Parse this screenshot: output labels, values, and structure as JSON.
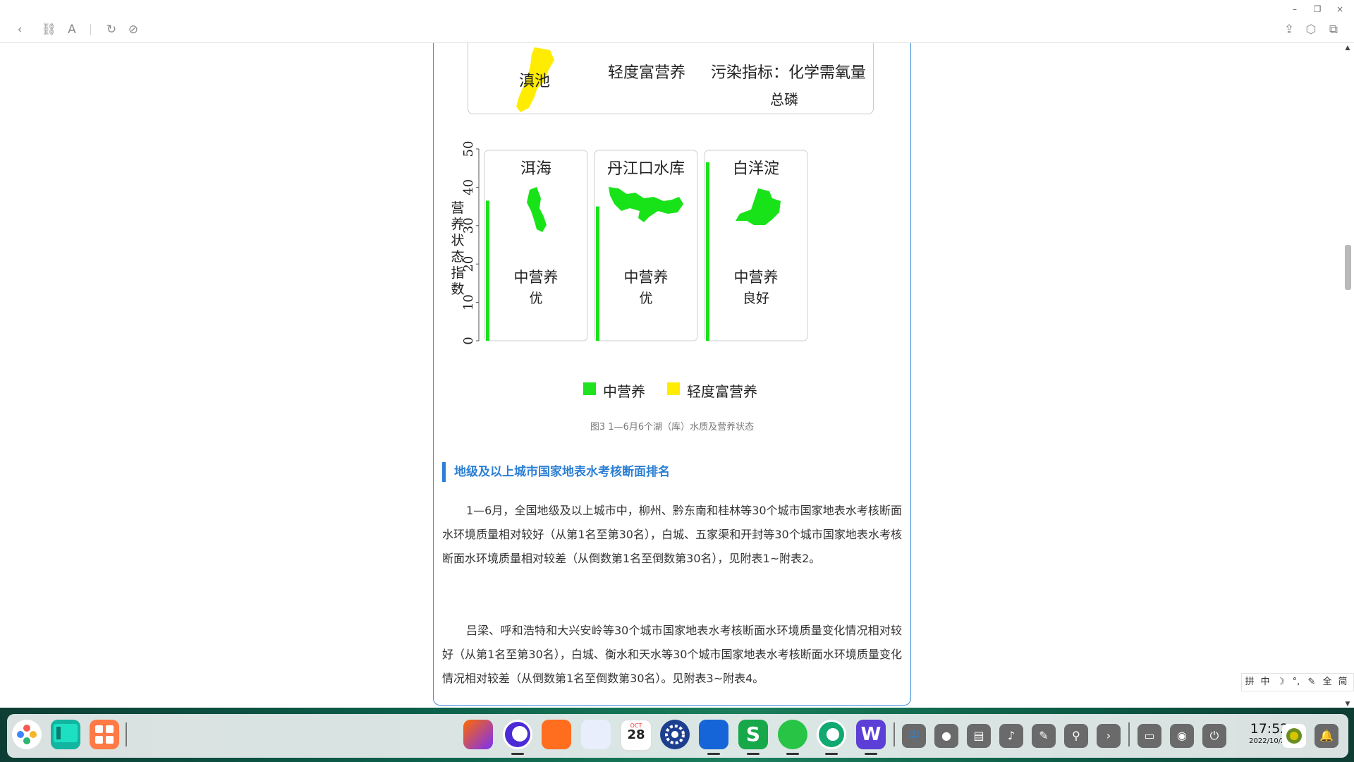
{
  "window": {
    "minimize": "–",
    "restore": "❐",
    "close": "×"
  },
  "article": {
    "map_label_dianchi": "滇池",
    "map_trophic": "轻度富营养",
    "map_pollution": "污染指标：化学需氧量",
    "map_pollution_2": "总磷",
    "caption": "图3 1—6月6个湖（库）水质及营养状态",
    "section_title": "地级及以上城市国家地表水考核断面排名",
    "para1": "1—6月，全国地级及以上城市中，柳州、黔东南和桂林等30个城市国家地表水考核断面水环境质量相对较好（从第1名至第30名），白城、五家渠和开封等30个城市国家地表水考核断面水环境质量相对较差（从倒数第1名至倒数第30名），见附表1~附表2。",
    "para2": "吕梁、呼和浩特和大兴安岭等30个城市国家地表水考核断面水环境质量变化情况相对较好（从第1名至第30名），白城、衡水和天水等30个城市国家地表水考核断面水环境质量变化情况相对较差（从倒数第1名至倒数第30名）。见附表3~附表4。"
  },
  "chart_data": {
    "type": "bar",
    "ylabel": "营养状态指数",
    "ylim": [
      0,
      50
    ],
    "yticks": [
      "0",
      "10",
      "20",
      "30",
      "40",
      "50"
    ],
    "categories": [
      "洱海",
      "丹江口水库",
      "白洋淀"
    ],
    "values": [
      36.5,
      35,
      46.5
    ],
    "state_labels": [
      "中营养",
      "中营养",
      "中营养"
    ],
    "quality_labels": [
      "优",
      "优",
      "良好"
    ],
    "bar_color": "#18e318",
    "legend": [
      {
        "name": "中营养",
        "color": "#1ee31e"
      },
      {
        "name": "轻度富营养",
        "color": "#ffec00"
      }
    ]
  },
  "ime": [
    "拼",
    "中",
    "☽",
    "°,",
    "✎",
    "全",
    "简"
  ],
  "clock": {
    "time": "17:52",
    "date": "2022/10/28"
  },
  "calendar": {
    "month": "OCT",
    "day": "28"
  }
}
